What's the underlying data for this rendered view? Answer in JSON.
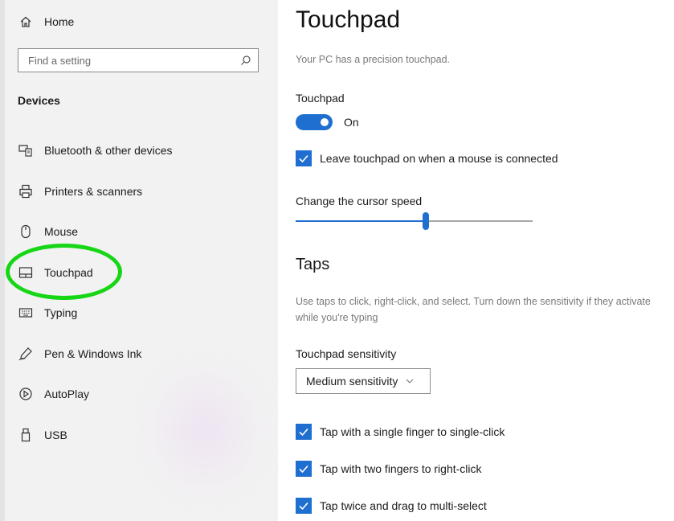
{
  "sidebar": {
    "home_label": "Home",
    "search_placeholder": "Find a setting",
    "section_title": "Devices",
    "items": [
      {
        "label": "Bluetooth & other devices",
        "icon": "bluetooth-devices-icon"
      },
      {
        "label": "Printers & scanners",
        "icon": "printer-icon"
      },
      {
        "label": "Mouse",
        "icon": "mouse-icon"
      },
      {
        "label": "Touchpad",
        "icon": "touchpad-icon",
        "selected": true
      },
      {
        "label": "Typing",
        "icon": "keyboard-icon"
      },
      {
        "label": "Pen & Windows Ink",
        "icon": "pen-icon"
      },
      {
        "label": "AutoPlay",
        "icon": "autoplay-icon"
      },
      {
        "label": "USB",
        "icon": "usb-icon"
      }
    ]
  },
  "main": {
    "title": "Touchpad",
    "subtitle": "Your PC has a precision touchpad.",
    "touchpad_label": "Touchpad",
    "toggle_state": "On",
    "toggle_on": true,
    "leave_on_label": "Leave touchpad on when a mouse is connected",
    "leave_on_checked": true,
    "cursor_speed_label": "Change the cursor speed",
    "cursor_speed_fraction": 0.55,
    "taps_heading": "Taps",
    "taps_description": "Use taps to click, right-click, and select. Turn down the sensitivity if they activate while you're typing",
    "sensitivity_label": "Touchpad sensitivity",
    "sensitivity_value": "Medium sensitivity",
    "tap_options": [
      {
        "label": "Tap with a single finger to single-click",
        "checked": true
      },
      {
        "label": "Tap with two fingers to right-click",
        "checked": true
      },
      {
        "label": "Tap twice and drag to multi-select",
        "checked": true
      }
    ]
  },
  "colors": {
    "accent": "#1e6fd0",
    "highlight_ring": "#16d616",
    "sidebar_bg": "#f2f2f2"
  }
}
